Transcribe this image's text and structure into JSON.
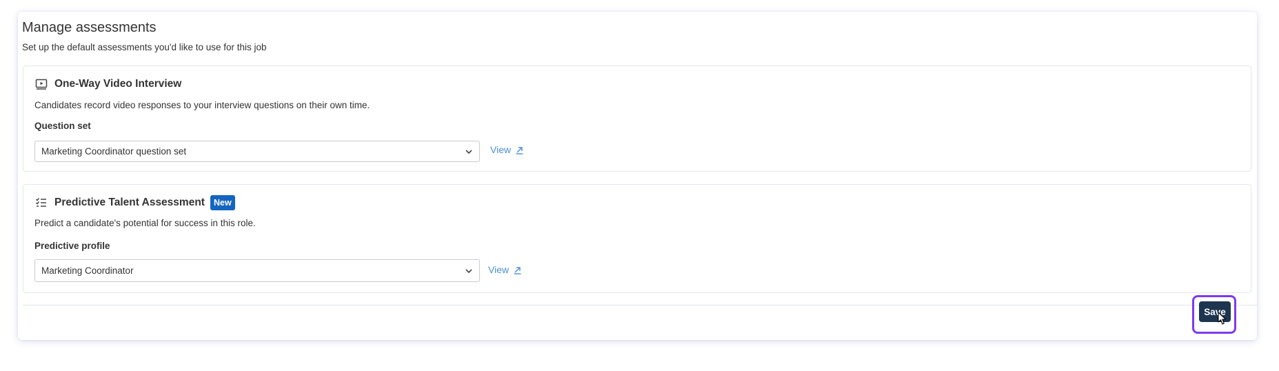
{
  "page": {
    "title": "Manage assessments",
    "subtitle": "Set up the default assessments you'd like to use for this job"
  },
  "sections": [
    {
      "icon": "video-icon",
      "title": "One-Way Video Interview",
      "description": "Candidates record video responses to your interview questions on their own time.",
      "field_label": "Question set",
      "selected_value": "Marketing Coordinator question set",
      "view_label": "View"
    },
    {
      "icon": "checklist-icon",
      "title": "Predictive Talent Assessment",
      "badge": "New",
      "description": "Predict a candidate's potential for success in this role.",
      "field_label": "Predictive profile",
      "selected_value": "Marketing Coordinator",
      "view_label": "View"
    }
  ],
  "footer": {
    "save_label": "Save"
  },
  "colors": {
    "accent_link": "#4a8fd6",
    "badge_bg": "#1565c0",
    "save_button_bg": "#1e3550",
    "highlight_border": "#7c3aed"
  }
}
